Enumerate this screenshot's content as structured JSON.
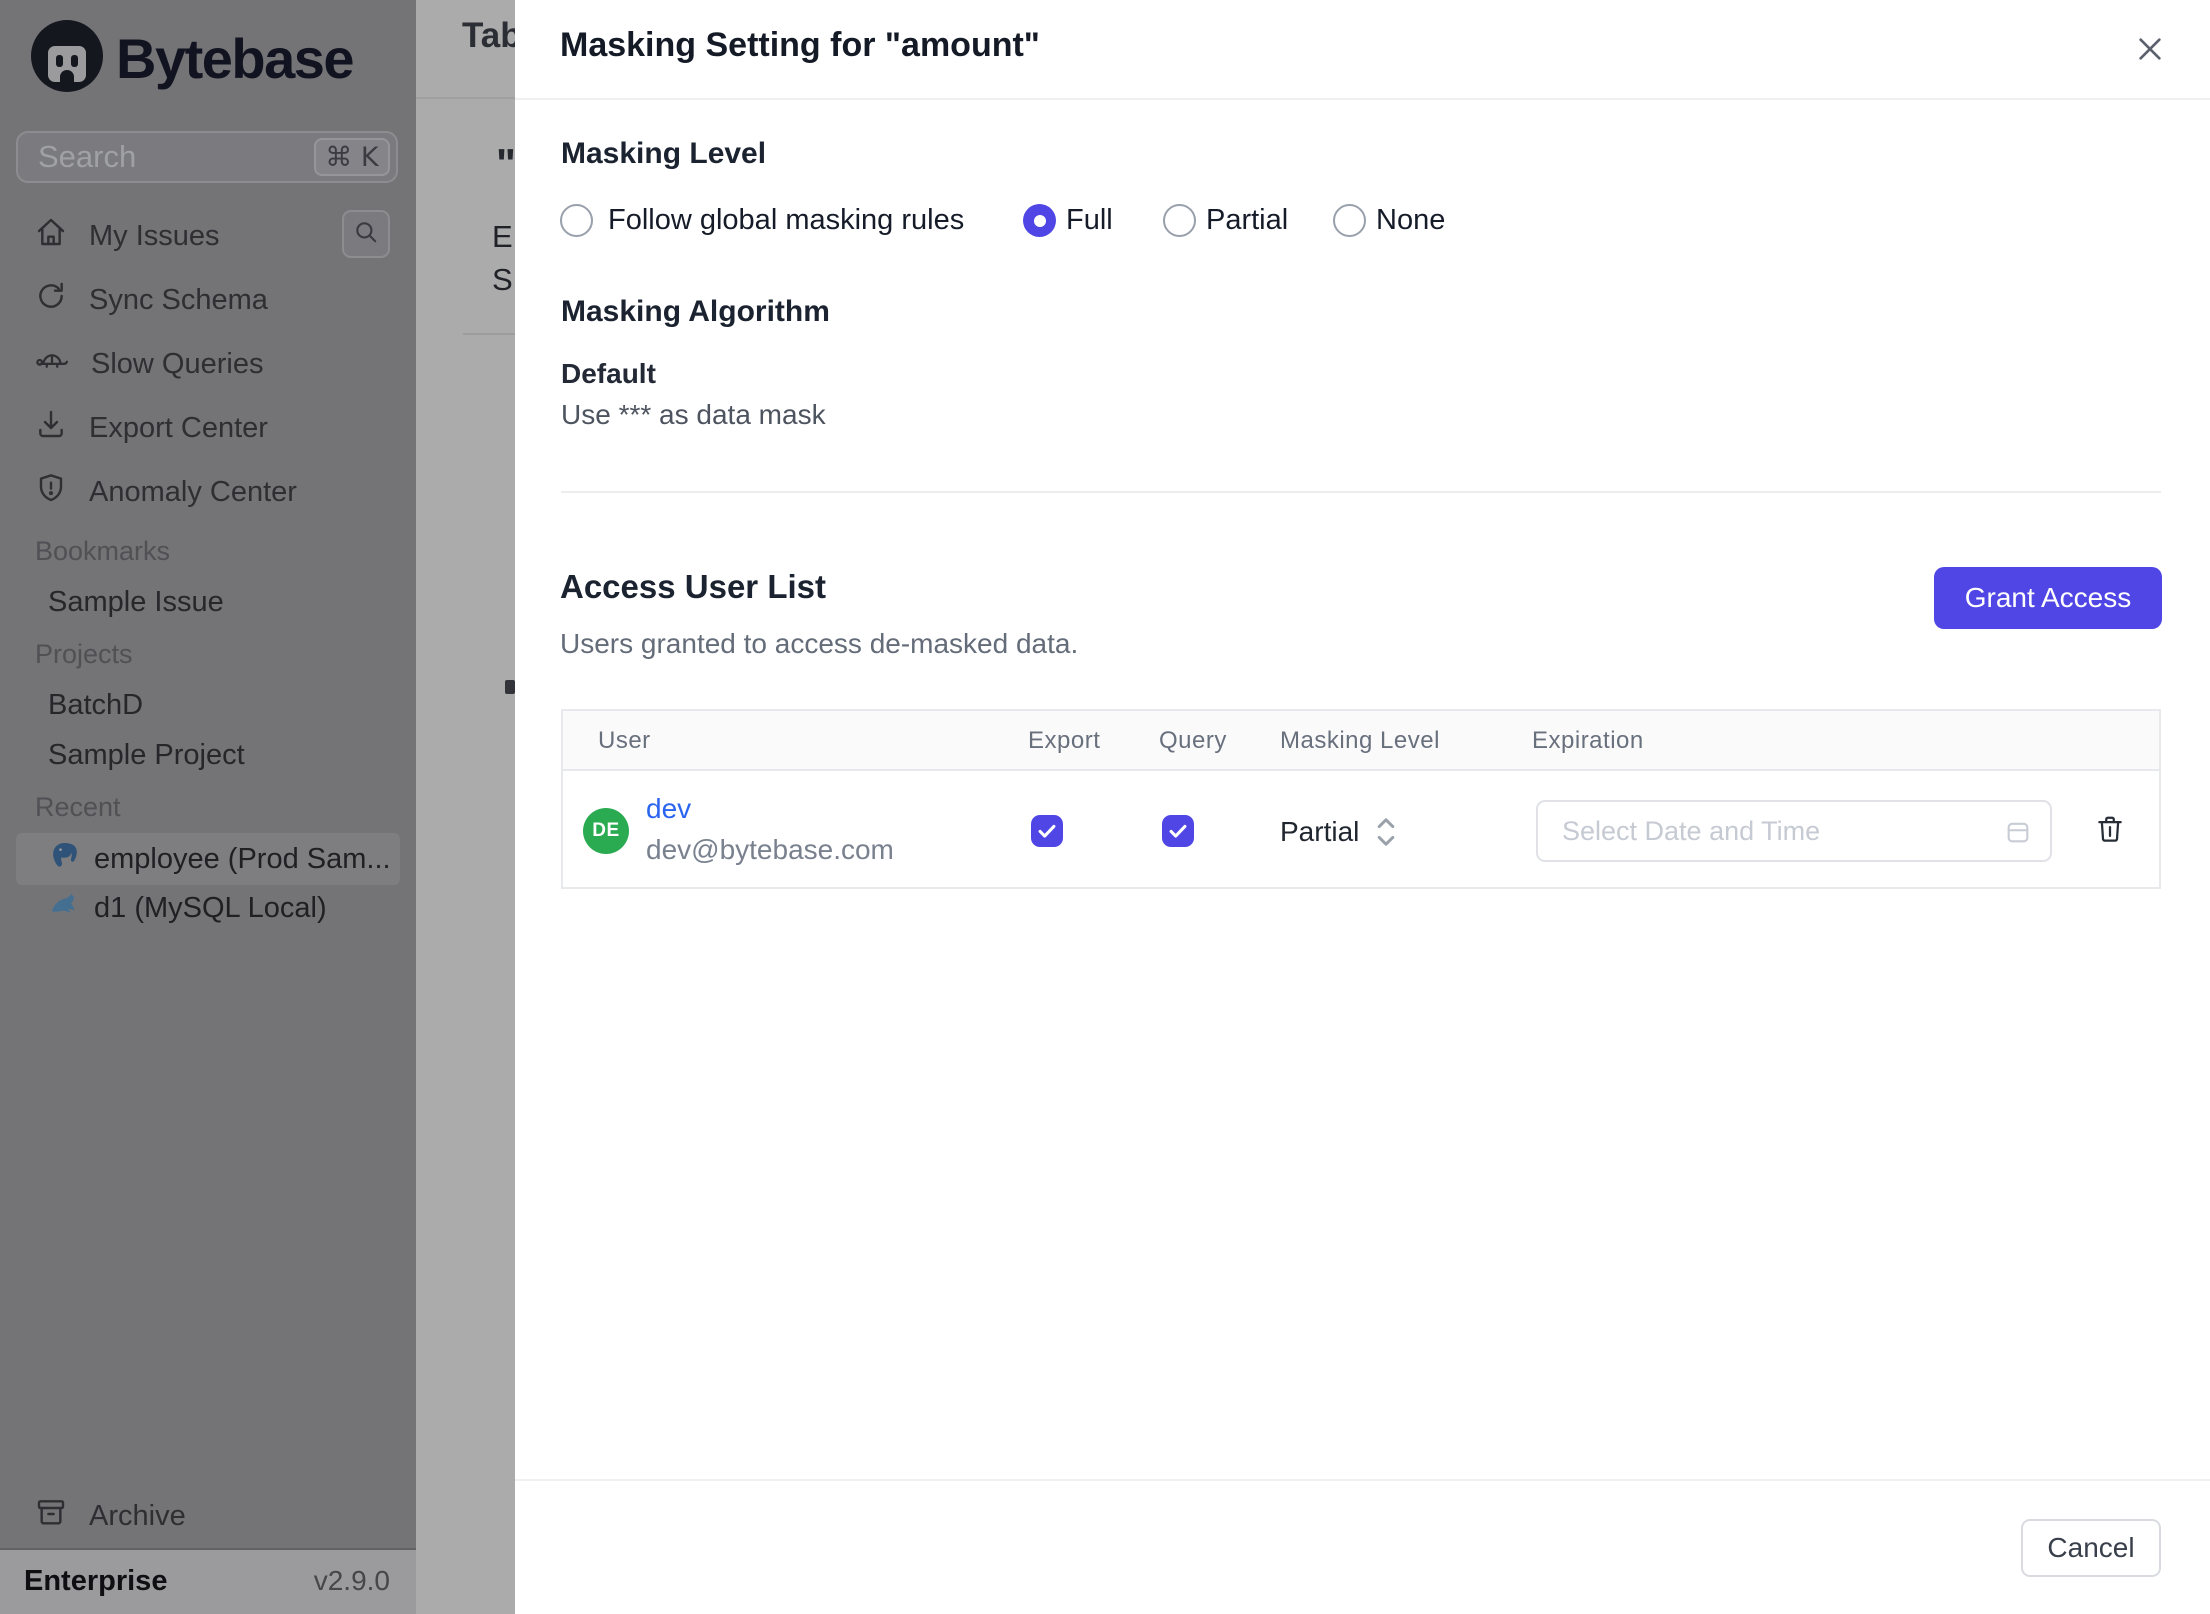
{
  "app": {
    "brand": "Bytebase",
    "plan": "Enterprise",
    "version": "v2.9.0"
  },
  "sidebar": {
    "search": {
      "placeholder": "Search",
      "shortcut": "⌘ K"
    },
    "items": [
      {
        "label": "My Issues",
        "icon": "home"
      },
      {
        "label": "Sync Schema",
        "icon": "sync"
      },
      {
        "label": "Slow Queries",
        "icon": "turtle"
      },
      {
        "label": "Export Center",
        "icon": "download"
      },
      {
        "label": "Anomaly Center",
        "icon": "shield"
      }
    ],
    "sections": [
      {
        "label": "Bookmarks",
        "items": [
          {
            "label": "Sample Issue"
          }
        ]
      },
      {
        "label": "Projects",
        "items": [
          {
            "label": "BatchD"
          },
          {
            "label": "Sample Project"
          }
        ]
      },
      {
        "label": "Recent",
        "items": [
          {
            "label": "employee (Prod Sam...",
            "icon": "postgresql",
            "active": true
          },
          {
            "label": "d1 (MySQL Local)",
            "icon": "mysql",
            "active": false
          }
        ]
      }
    ],
    "archive_label": "Archive"
  },
  "background_page": {
    "clipped_title": "Tab",
    "fragments": [
      "\"",
      "E",
      "S"
    ]
  },
  "modal": {
    "title": "Masking Setting for \"amount\"",
    "masking_level": {
      "heading": "Masking Level",
      "options": [
        {
          "label": "Follow global masking rules",
          "selected": false
        },
        {
          "label": "Full",
          "selected": true
        },
        {
          "label": "Partial",
          "selected": false
        },
        {
          "label": "None",
          "selected": false
        }
      ]
    },
    "masking_algorithm": {
      "heading": "Masking Algorithm",
      "name": "Default",
      "description": "Use *** as data mask"
    },
    "access": {
      "heading": "Access User List",
      "subtitle": "Users granted to access de-masked data.",
      "grant_button_label": "Grant Access",
      "table": {
        "columns": [
          "User",
          "Export",
          "Query",
          "Masking Level",
          "Expiration"
        ],
        "rows": [
          {
            "initials": "DE",
            "name": "dev",
            "email": "dev@bytebase.com",
            "export_checked": true,
            "query_checked": true,
            "masking_level": "Partial",
            "expiration_placeholder": "Select Date and Time"
          }
        ]
      }
    },
    "cancel_label": "Cancel"
  },
  "colors": {
    "accent": "#4f46e5",
    "avatar_green": "#2aab52",
    "link_blue": "#2b64ee"
  }
}
